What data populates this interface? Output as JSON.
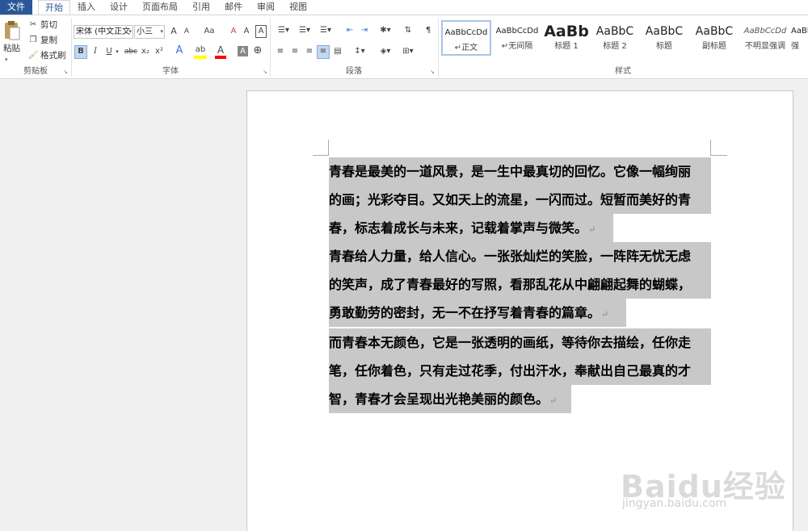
{
  "tabs": [
    "文件",
    "开始",
    "插入",
    "设计",
    "页面布局",
    "引用",
    "邮件",
    "审阅",
    "视图"
  ],
  "clipboard": {
    "paste": "粘贴",
    "cut": "剪切",
    "copy": "复制",
    "format_painter": "格式刷",
    "group_label": "剪贴板"
  },
  "font": {
    "name": "宋体 (中文正文",
    "size": "小三",
    "grow": "A",
    "shrink": "A",
    "case": "Aa",
    "clear": "A",
    "phonetic": "A",
    "border": "A",
    "bold": "B",
    "italic": "I",
    "underline": "U",
    "strike": "abc",
    "sub": "x₂",
    "sup": "x²",
    "effects": "A",
    "highlight": "ab",
    "color": "A",
    "shade": "A",
    "circle": "⊕",
    "group_label": "字体"
  },
  "paragraph": {
    "group_label": "段落"
  },
  "styles": {
    "group_label": "样式",
    "items": [
      {
        "preview": "AaBbCcDd",
        "name": "正文"
      },
      {
        "preview": "AaBbCcDd",
        "name": "无间隔"
      },
      {
        "preview": "AaBb",
        "name": "标题 1"
      },
      {
        "preview": "AaBbC",
        "name": "标题 2"
      },
      {
        "preview": "AaBbC",
        "name": "标题"
      },
      {
        "preview": "AaBbC",
        "name": "副标题"
      },
      {
        "preview": "AaBbCcDd",
        "name": "不明显强调"
      },
      {
        "preview": "AaBb",
        "name": "强"
      }
    ]
  },
  "paragraph_mark": "↵",
  "document": {
    "paragraphs": [
      {
        "lines": [
          "青春是最美的一道风景，是一生中最真切的回忆。它像一幅绚丽",
          "的画；光彩夺目。又如天上的流星，一闪而过。短暂而美好的青",
          "春，标志着成长与未来，记载着掌声与微笑。"
        ]
      },
      {
        "lines": [
          "青春给人力量，给人信心。一张张灿烂的笑脸，一阵阵无忧无虑",
          "的笑声，成了青春最好的写照，看那乱花从中翩翩起舞的蝴蝶，",
          "勇敢勤劳的密封，无一不在抒写着青春的篇章。"
        ]
      },
      {
        "lines": [
          "而青春本无颜色，它是一张透明的画纸，等待你去描绘，任你走",
          "笔，任你着色，只有走过花季，付出汗水，奉献出自己最真的才",
          "智，青春才会呈现出光艳美丽的颜色。"
        ]
      }
    ]
  },
  "watermark": {
    "text": "Baidu经验",
    "url": "jingyan.baidu.com"
  },
  "colors": {
    "accent": "#2b579a",
    "selection": "#c8c8c8",
    "highlight": "#ffff00",
    "font_color": "#ff0000"
  }
}
